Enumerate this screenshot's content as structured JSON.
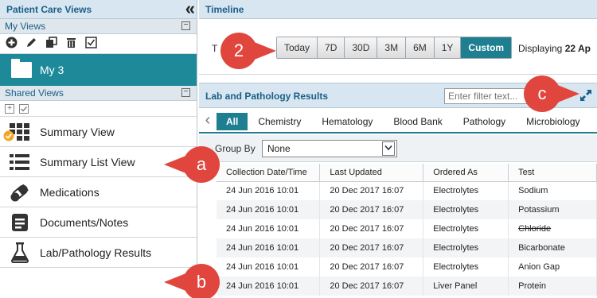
{
  "left_panel": {
    "title": "Patient Care Views",
    "collapse_glyph": "«",
    "my_views": {
      "label": "My Views",
      "toggle": "−"
    },
    "folder": {
      "label": "My 3"
    },
    "shared_views": {
      "label": "Shared Views",
      "toggle": "−"
    },
    "nav_items": [
      {
        "label": "Summary View",
        "icon": "grid-icon"
      },
      {
        "label": "Summary List View",
        "icon": "list-icon"
      },
      {
        "label": "Medications",
        "icon": "pills-icon"
      },
      {
        "label": "Documents/Notes",
        "icon": "document-icon"
      },
      {
        "label": "Lab/Pathology Results",
        "icon": "flask-icon"
      }
    ]
  },
  "timeline": {
    "title": "Timeline",
    "t_label": "T",
    "ranges": [
      "Today",
      "7D",
      "30D",
      "3M",
      "6M",
      "1Y",
      "Custom"
    ],
    "active_range": "Custom",
    "displaying_prefix": "Displaying ",
    "displaying_value": "22 Ap"
  },
  "lab": {
    "title": "Lab and Pathology Results",
    "filter_placeholder": "Enter filter text...",
    "tabs": [
      "All",
      "Chemistry",
      "Hematology",
      "Blood Bank",
      "Pathology",
      "Microbiology"
    ],
    "active_tab": "All",
    "group_by_label": "Group By",
    "group_by_value": "None",
    "columns": [
      "Collection Date/Time",
      "Last Updated",
      "Ordered As",
      "Test"
    ],
    "rows": [
      [
        "24 Jun 2016 10:01",
        "20 Dec 2017 16:07",
        "Electrolytes",
        "Sodium"
      ],
      [
        "24 Jun 2016 10:01",
        "20 Dec 2017 16:07",
        "Electrolytes",
        "Potassium"
      ],
      [
        "24 Jun 2016 10:01",
        "20 Dec 2017 16:07",
        "Electrolytes",
        "Chloride"
      ],
      [
        "24 Jun 2016 10:01",
        "20 Dec 2017 16:07",
        "Electrolytes",
        "Bicarbonate"
      ],
      [
        "24 Jun 2016 10:01",
        "20 Dec 2017 16:07",
        "Electrolytes",
        "Anion Gap"
      ],
      [
        "24 Jun 2016 10:01",
        "20 Dec 2017 16:07",
        "Liver Panel",
        "Protein"
      ]
    ]
  },
  "callouts": {
    "a": "a",
    "b": "b",
    "c": "c",
    "two": "2"
  },
  "colors": {
    "accent": "#1e7f91",
    "header": "#d7e6f1",
    "callout": "#e0463e",
    "check": "#f5a623"
  }
}
